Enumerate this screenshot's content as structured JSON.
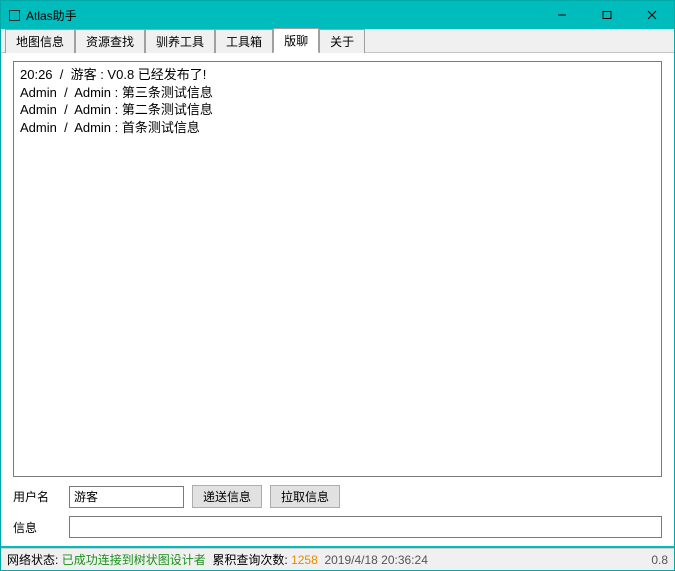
{
  "window": {
    "title": "Atlas助手"
  },
  "tabs": [
    {
      "label": "地图信息"
    },
    {
      "label": "资源查找"
    },
    {
      "label": "驯养工具"
    },
    {
      "label": "工具箱"
    },
    {
      "label": "版聊"
    },
    {
      "label": "关于"
    }
  ],
  "active_tab_index": 4,
  "chat": {
    "lines": [
      "20:26  /  游客 : V0.8 已经发布了!",
      "Admin  /  Admin : 第三条测试信息",
      "Admin  /  Admin : 第二条测试信息",
      "Admin  /  Admin : 首条测试信息"
    ]
  },
  "form": {
    "username_label": "用户名",
    "username_value": "游客",
    "send_button": "递送信息",
    "pull_button": "拉取信息",
    "message_label": "信息",
    "message_value": ""
  },
  "status": {
    "net_label": "网络状态:",
    "net_value": "已成功连接到树状图设计者",
    "query_label": "累积查询次数:",
    "query_count": "1258",
    "datetime": "2019/4/18 20:36:24",
    "version": "0.8"
  }
}
